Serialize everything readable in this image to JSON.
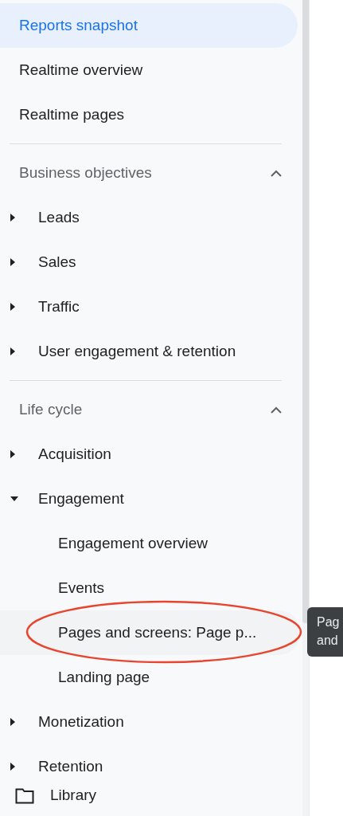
{
  "top_items": [
    {
      "label": "Reports snapshot",
      "selected": true
    },
    {
      "label": "Realtime overview",
      "selected": false
    },
    {
      "label": "Realtime pages",
      "selected": false
    }
  ],
  "sections": [
    {
      "title": "Business objectives",
      "expanded": true,
      "items": [
        {
          "label": "Leads",
          "expanded": false
        },
        {
          "label": "Sales",
          "expanded": false
        },
        {
          "label": "Traffic",
          "expanded": false
        },
        {
          "label": "User engagement & retention",
          "expanded": false
        }
      ]
    },
    {
      "title": "Life cycle",
      "expanded": true,
      "items": [
        {
          "label": "Acquisition",
          "expanded": false
        },
        {
          "label": "Engagement",
          "expanded": true,
          "children": [
            {
              "label": "Engagement overview",
              "hovered": false
            },
            {
              "label": "Events",
              "hovered": false
            },
            {
              "label": "Pages and screens: Page p...",
              "hovered": true
            },
            {
              "label": "Landing page",
              "hovered": false
            }
          ]
        },
        {
          "label": "Monetization",
          "expanded": false
        },
        {
          "label": "Retention",
          "expanded": false
        }
      ]
    }
  ],
  "footer": {
    "label": "Library"
  },
  "tooltip": {
    "lines": [
      "Pag",
      "and"
    ]
  }
}
